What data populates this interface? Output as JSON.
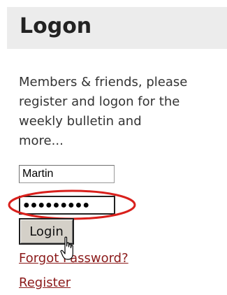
{
  "header": {
    "title": "Logon"
  },
  "intro": {
    "lines": [
      "Members & friends, please",
      "register and logon for the",
      "weekly bulletin and",
      "more..."
    ]
  },
  "form": {
    "username_value": "Martin",
    "password_value": "●●●●●●●●●",
    "login_label": "Login"
  },
  "links": {
    "forgot_password": "Forgot Password?",
    "register": "Register"
  },
  "colors": {
    "header_bg": "#ececec",
    "link": "#8b1a1a",
    "highlight": "#d9201c"
  },
  "icons": {
    "cursor": "hand-pointer-icon"
  }
}
